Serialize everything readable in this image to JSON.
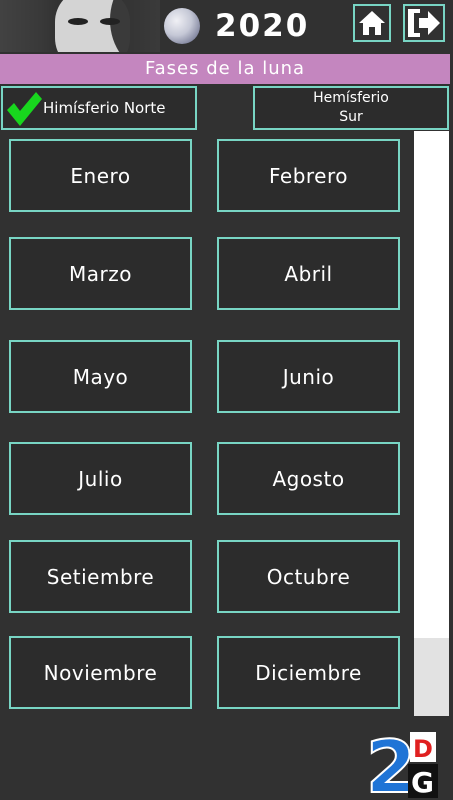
{
  "header": {
    "year": "2020",
    "home_icon": "home-icon",
    "exit_icon": "exit-icon",
    "moon_icon": "moon-icon"
  },
  "title": "Fases de la luna",
  "hemispheres": {
    "north": {
      "label": "Himísferio Norte",
      "selected": true
    },
    "south": {
      "label_line1": "Hemísferio",
      "label_line2": "Sur",
      "selected": false
    }
  },
  "months": [
    "Enero",
    "Febrero",
    "Marzo",
    "Abril",
    "Mayo",
    "Junio",
    "Julio",
    "Agosto",
    "Setiembre",
    "Octubre",
    "Noviembre",
    "Diciembre"
  ],
  "colors": {
    "accent": "#78d5c4",
    "title_bar": "#c486bf",
    "background": "#313131",
    "check": "#18d61e"
  },
  "logo": {
    "text_main": "2",
    "text_d": "D",
    "text_g": "G"
  }
}
